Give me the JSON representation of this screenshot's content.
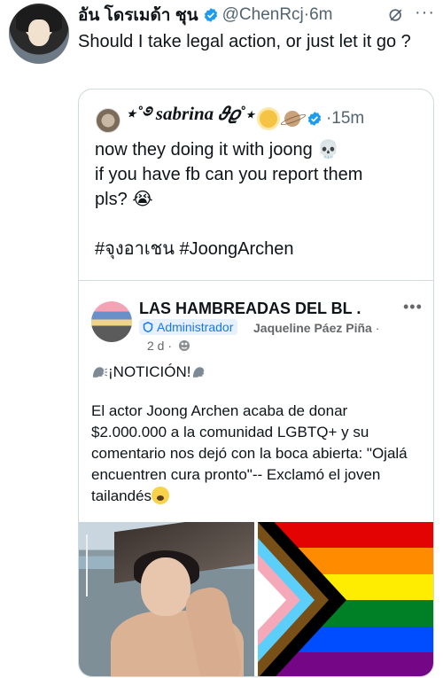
{
  "tweet": {
    "display_name": "อัน โดรเมด้า ชุน",
    "handle": "@ChenRcj",
    "time": "6m",
    "text": "Should I take legal action, or just let it go ?"
  },
  "quote": {
    "display_name": "⋆˚࿔ sabrina 𝜗𝜚˚⋆",
    "time": "15m",
    "lines": [
      "now they doing it with joong 💀",
      "if you have fb can you report them",
      "pls? 😭",
      "",
      "#จุงอาเชน #JoongArchen"
    ]
  },
  "facebook_post": {
    "group_name": "LAS HAMBREADAS DEL BL .",
    "more": "•••",
    "role": "Administrador",
    "user_name": "Jaqueline Páez Piña",
    "user_sep": " ·",
    "date": "2 d ·",
    "headline": "¡NOTICIÓN!",
    "body": "El actor Joong Archen acaba de donar $2.000.000 a la comunidad LGBTQ+ y su comentario nos dejó con la boca abierta: \"Ojalá encuentren cura pronto\"-- Exclamó el joven tailandés"
  },
  "icons": {
    "verified": "verified-badge-icon",
    "grok": "grok-icon",
    "more": "more-icon",
    "globe": "globe-icon",
    "speaking": "speaking-head-icon",
    "admin_shield": "shield-icon"
  },
  "colors": {
    "verified_blue": "#1d9bf0",
    "fb_blue": "#1877f2",
    "secondary_text": "#536471",
    "border": "#cfd9de"
  }
}
